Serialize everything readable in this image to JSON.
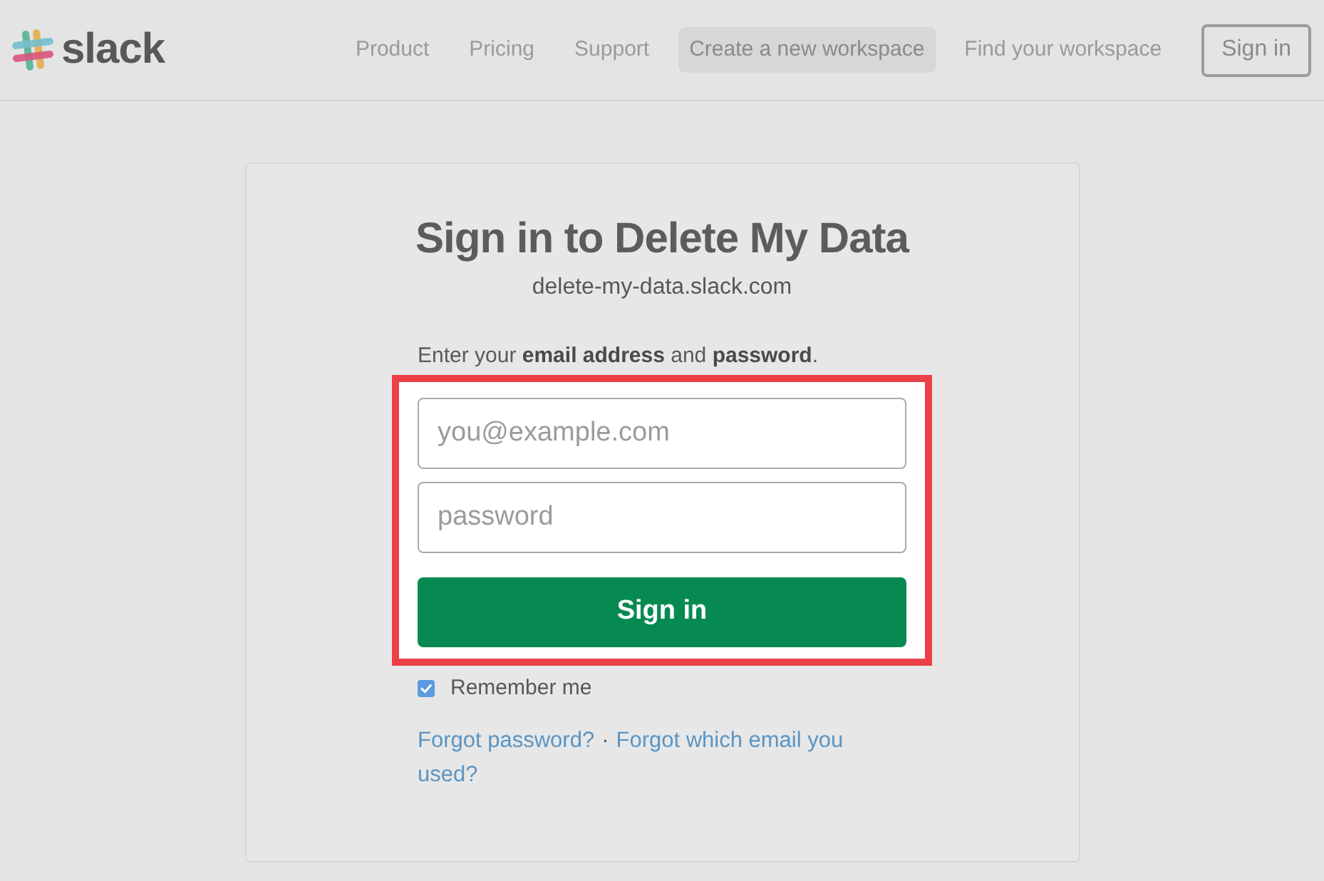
{
  "header": {
    "logo": {
      "wordmark": "slack"
    },
    "nav": [
      {
        "label": "Product",
        "kind": "link"
      },
      {
        "label": "Pricing",
        "kind": "link"
      },
      {
        "label": "Support",
        "kind": "link"
      },
      {
        "label": "Create a new workspace",
        "kind": "pill"
      },
      {
        "label": "Find your workspace",
        "kind": "link"
      },
      {
        "label": "Sign in",
        "kind": "outline"
      }
    ]
  },
  "card": {
    "title": "Sign in to Delete My Data",
    "domain": "delete-my-data.slack.com",
    "instructions": "Enter your **email address** and **password**.",
    "form": {
      "highlighted": true,
      "email": {
        "placeholder": "you@example.com"
      },
      "password": {
        "placeholder": "password"
      },
      "submit": "Sign in"
    },
    "remember_me": {
      "label": "Remember me",
      "checked": true
    },
    "links": [
      "Forgot password?",
      "Forgot which email you used?"
    ],
    "separator": "·"
  }
}
